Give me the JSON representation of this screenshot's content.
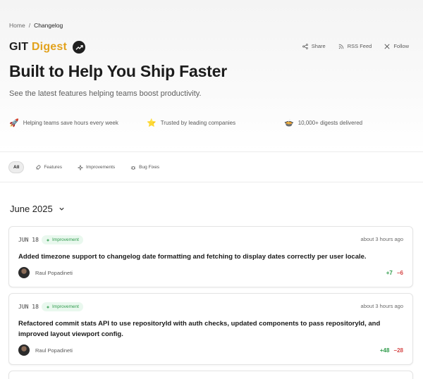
{
  "breadcrumb": {
    "home": "Home",
    "sep": "/",
    "current": "Changelog"
  },
  "brand": {
    "part1": "GIT",
    "part2": "Digest",
    "icon": "trending-up-icon"
  },
  "actions": [
    {
      "label": "Share",
      "icon": "share-icon"
    },
    {
      "label": "RSS Feed",
      "icon": "rss-icon"
    },
    {
      "label": "Follow",
      "icon": "x-logo-icon"
    }
  ],
  "hero": {
    "title": "Built to Help You Ship Faster",
    "subtitle": "See the latest features helping teams boost productivity."
  },
  "features": [
    {
      "emoji": "🚀",
      "text": "Helping teams save hours every week"
    },
    {
      "emoji": "⭐",
      "text": "Trusted by leading companies"
    },
    {
      "emoji": "🍲",
      "text": "10,000+ digests delivered"
    }
  ],
  "filters": {
    "all": "All",
    "features": "Features",
    "improvements": "Improvements",
    "bugfixes": "Bug Fixes"
  },
  "month": {
    "label": "June 2025"
  },
  "entries": [
    {
      "date": "JUN 18",
      "badge": "Improvement",
      "time": "about 3 hours ago",
      "title": "Added timezone support to changelog date formatting and fetching to display dates correctly per user locale.",
      "author": "Raul Popadineti",
      "additions": "+7",
      "deletions": "−6"
    },
    {
      "date": "JUN 18",
      "badge": "Improvement",
      "time": "about 3 hours ago",
      "title": "Refactored commit stats API to use repositoryId with auth checks, updated components to pass repositoryId, and improved layout viewport config.",
      "author": "Raul Popadineti",
      "additions": "+48",
      "deletions": "−28"
    }
  ],
  "colors": {
    "accent": "#e2a21d",
    "badge_bg": "#e9f8ee",
    "badge_fg": "#2f9a4c",
    "add": "#2e9b4a",
    "del": "#d64545"
  }
}
